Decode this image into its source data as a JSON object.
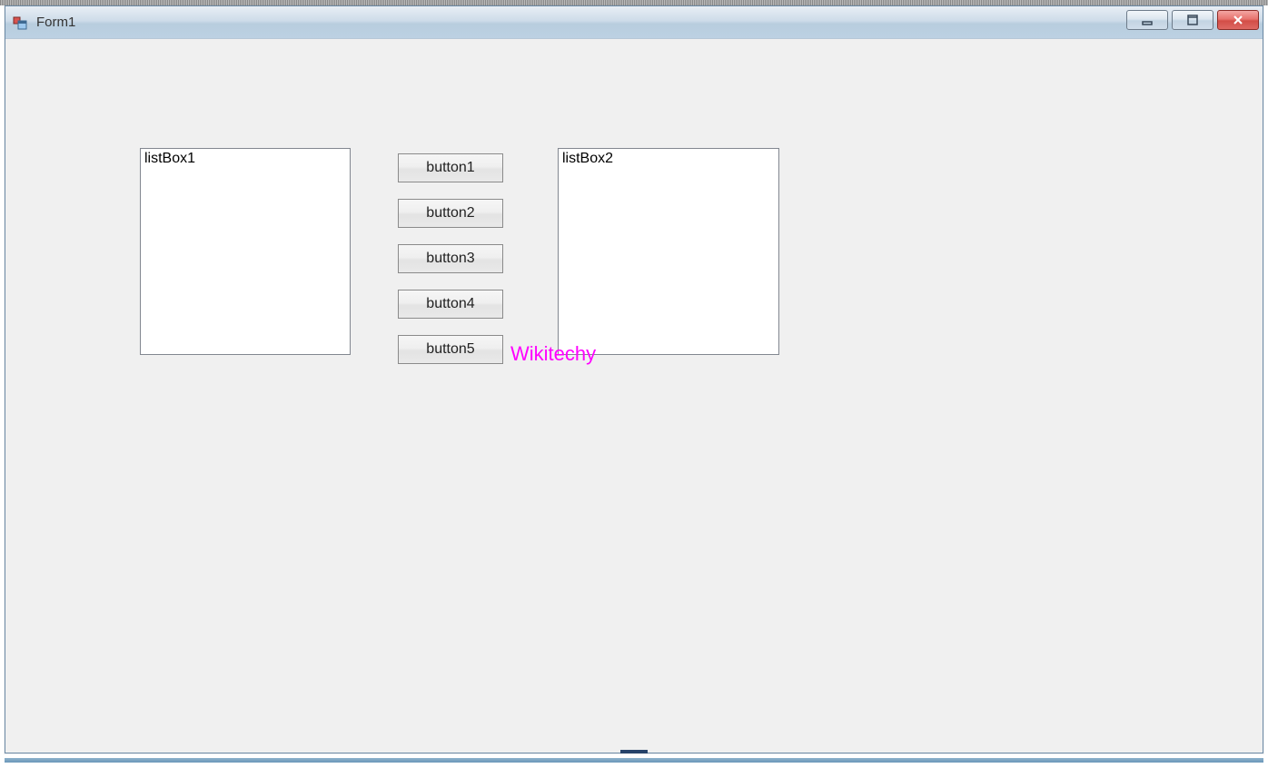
{
  "window": {
    "title": "Form1"
  },
  "listbox1": {
    "label": "listBox1"
  },
  "listbox2": {
    "label": "listBox2"
  },
  "buttons": {
    "b1": "button1",
    "b2": "button2",
    "b3": "button3",
    "b4": "button4",
    "b5": "button5"
  },
  "watermark": "Wikitechy"
}
